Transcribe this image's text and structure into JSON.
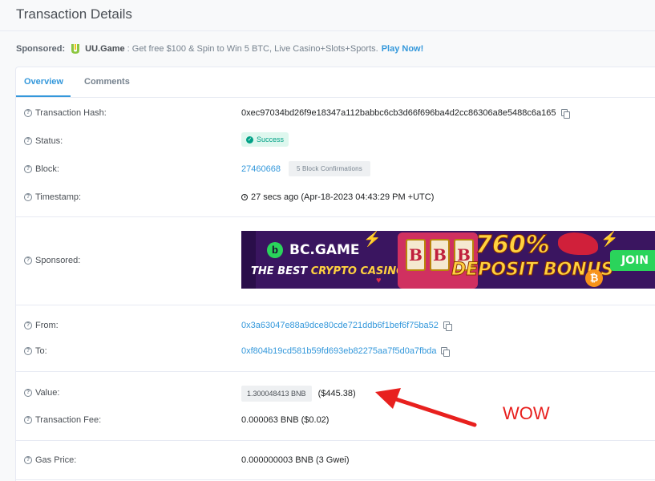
{
  "header": {
    "title": "Transaction Details"
  },
  "sponsored_bar": {
    "label": "Sponsored:",
    "brand": "UU.Game",
    "text": ": Get free $100 & Spin to Win 5 BTC, Live Casino+Slots+Sports.",
    "link": "Play Now!"
  },
  "tabs": [
    {
      "label": "Overview",
      "active": true
    },
    {
      "label": "Comments",
      "active": false
    }
  ],
  "fields": {
    "hash": {
      "label": "Transaction Hash:",
      "value": "0xec97034bd26f9e18347a112babbc6cb3d66f696ba4d2cc86306a8e5488c6a165"
    },
    "status": {
      "label": "Status:",
      "value": "Success"
    },
    "block": {
      "label": "Block:",
      "value": "27460668",
      "confirmations": "5 Block Confirmations"
    },
    "timestamp": {
      "label": "Timestamp:",
      "value": "27 secs ago (Apr-18-2023 04:43:29 PM +UTC)"
    },
    "sponsored": {
      "label": "Sponsored:"
    },
    "from": {
      "label": "From:",
      "value": "0x3a63047e88a9dce80cde721ddb6f1bef6f75ba52"
    },
    "to": {
      "label": "To:",
      "value": "0xf804b19cd581b59fd693eb82275aa7f5d0a7fbda"
    },
    "value": {
      "label": "Value:",
      "amount": "1.300048413 BNB",
      "usd": "($445.38)"
    },
    "fee": {
      "label": "Transaction Fee:",
      "value": "0.000063 BNB ($0.02)"
    },
    "gas": {
      "label": "Gas Price:",
      "value": "0.000000003 BNB (3 Gwei)"
    }
  },
  "ad_banner": {
    "brand": "BC.GAME",
    "tagline_white": "THE BEST ",
    "tagline_yellow": "CRYPTO CASINO",
    "bonus_big": "760%",
    "bonus_small": "DEPOSIT BONUS",
    "cta": "JOIN",
    "slot_symbol": "B",
    "coin_symbol": "₿"
  },
  "annotation": {
    "text": "WOW",
    "color": "#e8201e"
  },
  "colors": {
    "link": "#3498db",
    "success": "#00a186",
    "accent_red": "#e8201e"
  },
  "icons": [
    "question-circle-icon",
    "copy-icon",
    "check-circle-icon",
    "clock-icon",
    "uu-game-logo-icon"
  ]
}
